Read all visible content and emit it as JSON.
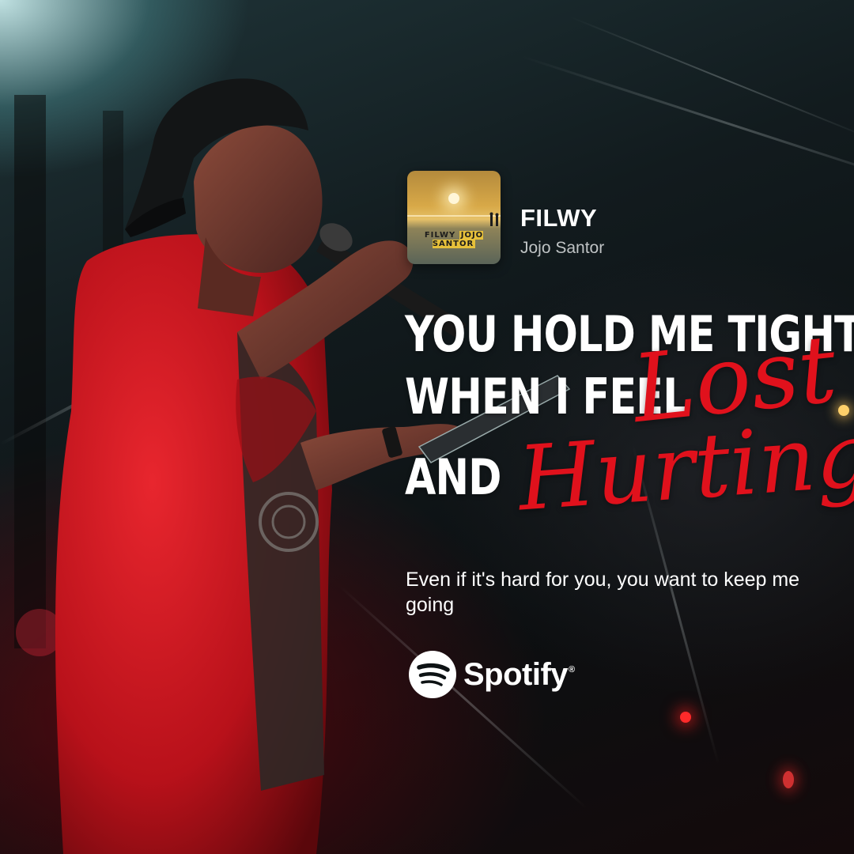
{
  "track": {
    "title": "FILWY",
    "artist": "Jojo Santor",
    "album_art_text": {
      "word1": "FILWY",
      "word2": "JOJO SANTOR"
    }
  },
  "lyrics": {
    "line1": "YOU HOLD ME TIGHT",
    "line2": "WHEN I FEEL",
    "line3": "AND",
    "script1": "Lost",
    "script2": "Hurting"
  },
  "subtitle": "Even if it's hard for you, you want to keep me going",
  "brand": {
    "name": "Spotify",
    "mark": "®",
    "icon": "spotify-icon"
  },
  "colors": {
    "accent_red": "#e0111c",
    "text_white": "#ffffff",
    "artist_gray": "#bfc3c4",
    "shirt_red": "#c8141c"
  }
}
